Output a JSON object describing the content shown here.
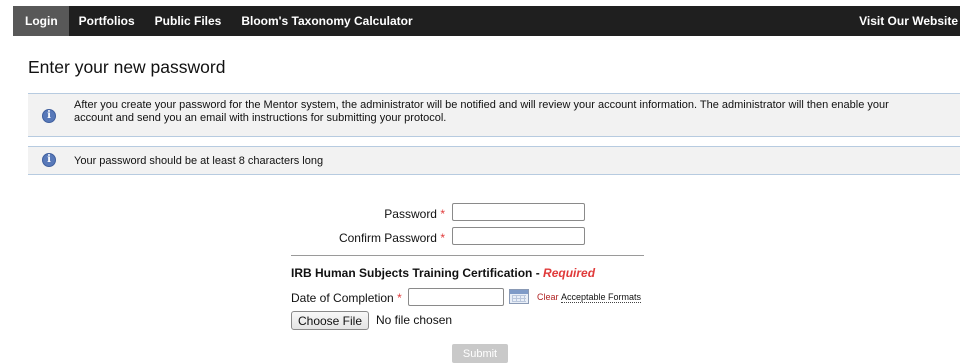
{
  "nav": {
    "items": [
      {
        "label": "Login"
      },
      {
        "label": "Portfolios"
      },
      {
        "label": "Public Files"
      },
      {
        "label": "Bloom's Taxonomy Calculator"
      }
    ],
    "right_link": "Visit Our Website"
  },
  "page_title": "Enter your new password",
  "info_messages": [
    {
      "icon": "info-icon",
      "text": "After you create your password for the Mentor system, the administrator will be notified and will review your account information. The administrator will then enable your account and send you an email with instructions for submitting your protocol."
    },
    {
      "icon": "info-icon",
      "text": "Your password should be at least 8 characters long"
    }
  ],
  "form": {
    "password_label": "Password",
    "password_value": "",
    "confirm_label": "Confirm Password",
    "confirm_value": "",
    "required_marker": "*",
    "certification_heading": "IRB Human Subjects Training Certification - ",
    "required_text": "Required",
    "date_label": "Date of Completion",
    "date_value": "",
    "clear_link": "Clear",
    "formats_link": "Acceptable Formats",
    "file_button": "Choose File",
    "file_status": "No file chosen",
    "submit_label": "Submit"
  },
  "colors": {
    "nav_bg": "#1f1f1f",
    "nav_active": "#585858",
    "required": "#e03a3a",
    "info_border": "#b7cbe0",
    "submit_disabled": "#c9c9c9"
  }
}
